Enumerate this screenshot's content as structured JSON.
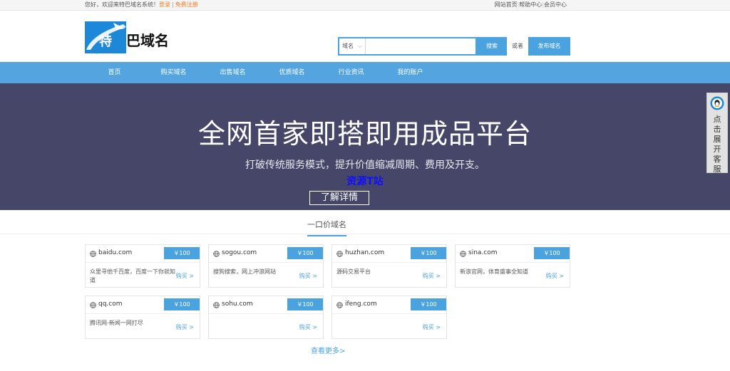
{
  "topbar": {
    "welcome": "您好，欢迎来特巴域名系统！",
    "login": "登录",
    "separator": "|",
    "register": "免费注册",
    "links": [
      "网站首页",
      "帮助中心",
      "会员中心"
    ]
  },
  "header": {
    "logo_text": "特巴域名",
    "search_type": "域名",
    "search_value": "",
    "search_button": "搜索",
    "or_text": "或者",
    "publish_button": "发布域名"
  },
  "nav": [
    "首页",
    "购买域名",
    "出售域名",
    "优质域名",
    "行业资讯",
    "我的账户"
  ],
  "banner": {
    "title": "全网首家即搭即用成品平台",
    "subtitle": "打破传统服务模式，提升价值缩减周期、费用及开支。",
    "watermark": "资源T站",
    "button": "了解详情"
  },
  "section": {
    "title": "一口价域名",
    "view_more": "查看更多>"
  },
  "cards": [
    {
      "domain": "baidu.com",
      "price": "￥100",
      "desc": "众里寻他千百度，百度一下你就知道",
      "buy": "购买 >"
    },
    {
      "domain": "sogou.com",
      "price": "￥100",
      "desc": "搜狗搜索，网上冲浪网站",
      "buy": "购买 >"
    },
    {
      "domain": "huzhan.com",
      "price": "￥100",
      "desc": "源码交易平台",
      "buy": "购买 >"
    },
    {
      "domain": "sina.com",
      "price": "￥100",
      "desc": "新浪官网，体育盛事全知道",
      "buy": "购买 >"
    },
    {
      "domain": "qq.com",
      "price": "￥100",
      "desc": "腾讯网-新闻一网打尽",
      "buy": "购买 >"
    },
    {
      "domain": "sohu.com",
      "price": "￥100",
      "desc": "",
      "buy": "购买 >"
    },
    {
      "domain": "ifeng.com",
      "price": "￥100",
      "desc": "",
      "buy": "购买 >"
    }
  ],
  "side_float": {
    "label": "点击展开客服"
  },
  "colors": {
    "accent": "#4aa3df",
    "nav": "#53a4df",
    "banner_bg": "#464768",
    "orange": "#f47920"
  }
}
